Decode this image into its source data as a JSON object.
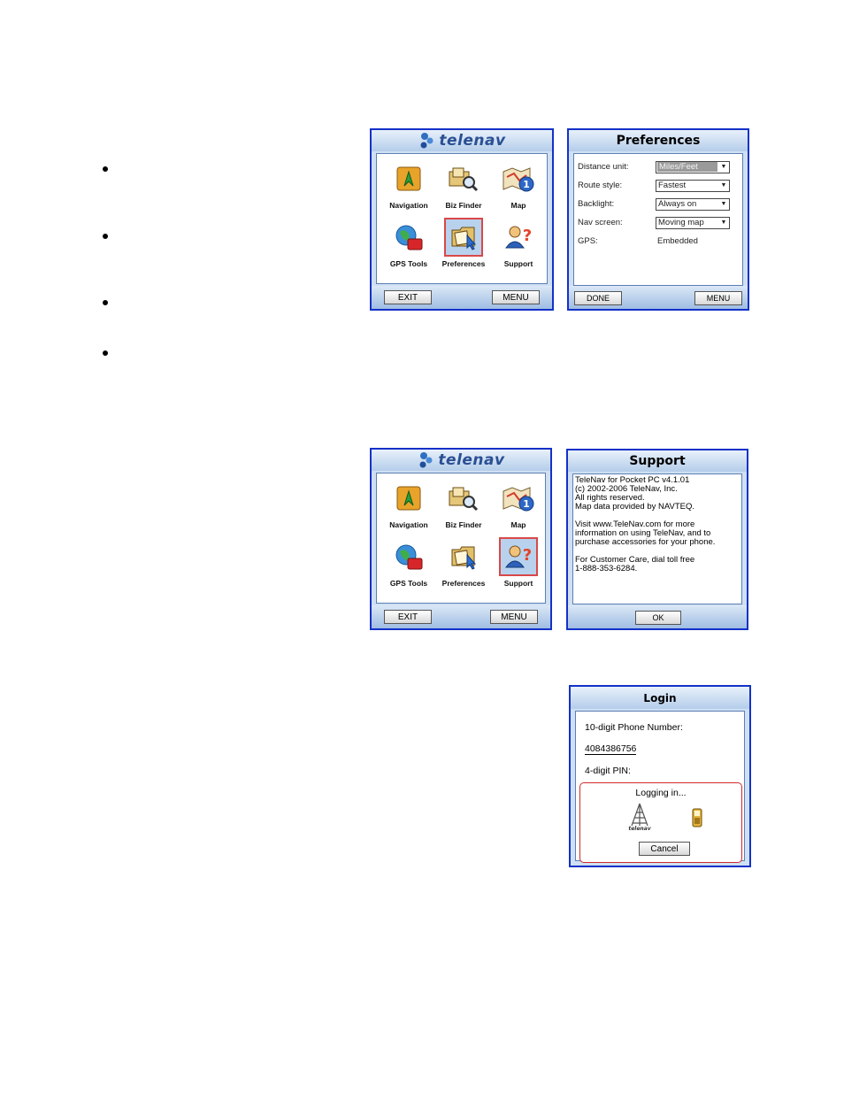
{
  "colors": {
    "frame": "#1431c8",
    "selection": "#d94848",
    "titlebar": "#b4cdea"
  },
  "bullets": [
    "",
    "",
    "",
    ""
  ],
  "main_menu_1": {
    "logo_text": "telenav",
    "items": [
      {
        "label": "Navigation",
        "icon": "navigation-icon"
      },
      {
        "label": "Biz Finder",
        "icon": "biz-finder-icon"
      },
      {
        "label": "Map",
        "icon": "map-icon"
      },
      {
        "label": "GPS Tools",
        "icon": "gps-tools-icon"
      },
      {
        "label": "Preferences",
        "icon": "preferences-icon",
        "selected": true
      },
      {
        "label": "Support",
        "icon": "support-icon"
      }
    ],
    "exit_label": "EXIT",
    "menu_label": "MENU"
  },
  "preferences": {
    "title": "Preferences",
    "rows": [
      {
        "label": "Distance unit:",
        "value": "Miles/Feet"
      },
      {
        "label": "Route style:",
        "value": "Fastest"
      },
      {
        "label": "Backlight:",
        "value": "Always on"
      },
      {
        "label": "Nav screen:",
        "value": "Moving map"
      },
      {
        "label": "GPS:",
        "value": "Embedded"
      }
    ],
    "done_label": "DONE",
    "menu_label": "MENU"
  },
  "main_menu_2": {
    "logo_text": "telenav",
    "items": [
      {
        "label": "Navigation",
        "icon": "navigation-icon"
      },
      {
        "label": "Biz Finder",
        "icon": "biz-finder-icon"
      },
      {
        "label": "Map",
        "icon": "map-icon"
      },
      {
        "label": "GPS Tools",
        "icon": "gps-tools-icon"
      },
      {
        "label": "Preferences",
        "icon": "preferences-icon"
      },
      {
        "label": "Support",
        "icon": "support-icon",
        "selected": true
      }
    ],
    "exit_label": "EXIT",
    "menu_label": "MENU"
  },
  "support": {
    "title": "Support",
    "lines1": [
      "TeleNav for Pocket PC v4.1.01",
      "(c) 2002-2006 TeleNav, Inc.",
      "All rights reserved.",
      "Map data provided by NAVTEQ."
    ],
    "lines2": [
      "Visit www.TeleNav.com for more",
      "information on using TeleNav, and to",
      "purchase accessories for your phone."
    ],
    "lines3": [
      "For Customer Care, dial toll free",
      "1-888-353-6284."
    ],
    "ok_label": "OK"
  },
  "login": {
    "title": "Login",
    "phone_label": "10-digit Phone Number:",
    "phone_value": "4084386756",
    "pin_label": "4-digit PIN:",
    "status": "Logging in...",
    "tower_caption": "telenav",
    "cancel_label": "Cancel"
  }
}
